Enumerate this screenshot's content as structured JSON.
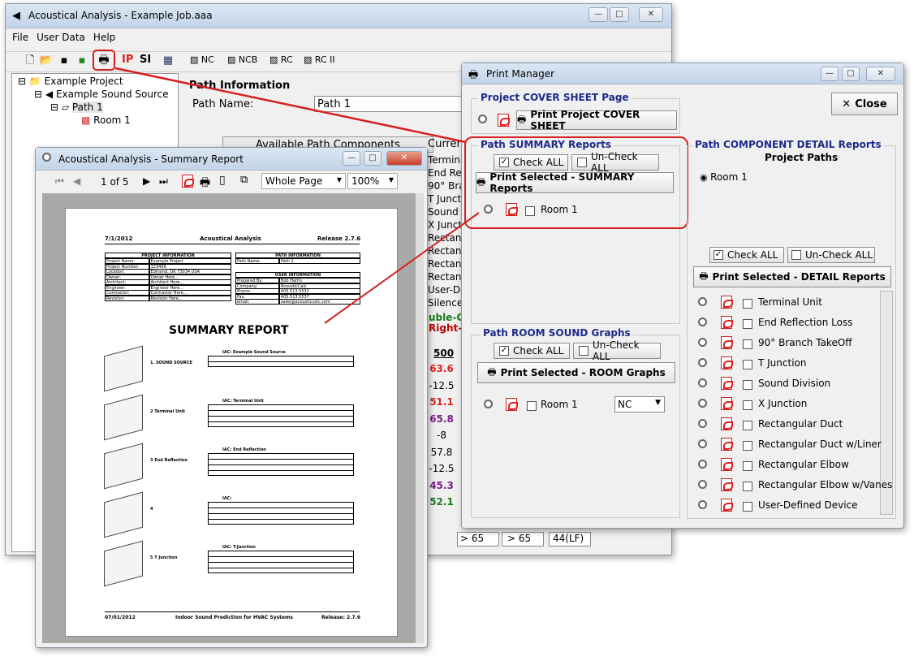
{
  "main": {
    "title": "Acoustical Analysis - Example Job.aaa",
    "menu": [
      "File",
      "User Data",
      "Help"
    ],
    "toolbar": {
      "ip": "IP",
      "si": "SI",
      "nc": "NC",
      "ncb": "NCB",
      "rc": "RC",
      "rc2": "RC II"
    },
    "tree": {
      "project": "Example Project",
      "source": "Example Sound Source",
      "path": "Path 1",
      "room": "Room 1"
    },
    "path_info": {
      "heading": "Path Information",
      "name_label": "Path Name:",
      "name_value": "Path 1",
      "avail": "Available Path Components",
      "curr": "Curren"
    },
    "components": [
      "Terminal",
      "End Reflec",
      "90° Branch",
      "T Junction",
      "Sound Div",
      "X Junction",
      "Rectangu",
      "Rectangu",
      "Rectangu",
      "Rectangu",
      "User-Defi",
      "Silencer"
    ],
    "dbl_click": "uble-Clic",
    "right_click": "Right-Cl",
    "col_head": "500",
    "col_values": [
      {
        "v": "63.6",
        "c": "#d22"
      },
      {
        "v": "-12.5",
        "c": "#000"
      },
      {
        "v": "51.1",
        "c": "#d22"
      },
      {
        "v": "65.8",
        "c": "#7a1c8a"
      },
      {
        "v": "-8",
        "c": "#000"
      },
      {
        "v": "57.8",
        "c": "#000"
      },
      {
        "v": "-12.5",
        "c": "#000"
      },
      {
        "v": "45.3",
        "c": "#7a1c8a"
      },
      {
        "v": "52.1",
        "c": "#1a7a1a"
      }
    ],
    "bottom": [
      "> 65",
      "> 65",
      "44(LF)"
    ]
  },
  "summary": {
    "title": "Acoustical Analysis - Summary Report",
    "pages": "1 of 5",
    "zoom_mode": "Whole Page",
    "zoom_pct": "100%",
    "doc": {
      "date": "7/1/2012",
      "app": "Acoustical Analysis",
      "release": "Release 2.7.6",
      "proj_info": "PROJECT INFORMATION",
      "path_info": "PATH INFORMATION",
      "user_info": "USER INFORMATION",
      "proj_rows": [
        [
          "Project Name:",
          "Example Project"
        ],
        [
          "Project Number:",
          "123456"
        ],
        [
          "Location:",
          "Edmond, OK 73034 USA"
        ],
        [
          "Owner:",
          "Owner Here..."
        ],
        [
          "Architect:",
          "Architect Here..."
        ],
        [
          "Engineer:",
          "Engineer Here..."
        ],
        [
          "Contractor:",
          "Contractor Here..."
        ],
        [
          "Revision:",
          "Revision Here..."
        ]
      ],
      "path_rows": [
        [
          "Path Name:",
          "Path 1"
        ]
      ],
      "user_rows": [
        [
          "Prepared By:",
          "Bob Harris"
        ],
        [
          "Company:",
          "AcousticCalc"
        ],
        [
          "Phone:",
          "405.513.5532"
        ],
        [
          "Fax:",
          "405.513.5537"
        ],
        [
          "email:",
          "sales@acousticcalc.com"
        ]
      ],
      "heading": "SUMMARY REPORT",
      "items": [
        {
          "label": "1. SOUND SOURCE",
          "iac": "IAC: Example Sound Source"
        },
        {
          "label": "2 Terminal Unit",
          "iac": "IAC: Terminal Unit"
        },
        {
          "label": "3 End Reflection",
          "iac": "IAC: End Reflection"
        },
        {
          "label": "4",
          "iac": "IAC:"
        },
        {
          "label": "5 T Junction",
          "iac": "IAC: T-Junction"
        }
      ],
      "footer_date": "07/01/2012",
      "footer_mid": "Indoor Sound Prediction for HVAC Systems",
      "footer_rel": "Release: 2.7.6"
    }
  },
  "pm": {
    "title": "Print Manager",
    "close": "Close",
    "cover": {
      "title": "Project COVER SHEET Page",
      "btn": "Print Project COVER SHEET"
    },
    "summ": {
      "title": "Path SUMMARY Reports",
      "check": "Check ALL",
      "uncheck": "Un-Check ALL",
      "btn": "Print Selected - SUMMARY Reports",
      "room": "Room 1"
    },
    "room": {
      "title": "Path ROOM SOUND Graphs",
      "check": "Check ALL",
      "uncheck": "Un-Check ALL",
      "btn": "Print Selected - ROOM Graphs",
      "room": "Room 1",
      "sel": "NC"
    },
    "detail": {
      "title": "Path COMPONENT DETAIL Reports",
      "sub": "Project Paths",
      "radio": "Room 1",
      "check": "Check ALL",
      "uncheck": "Un-Check ALL",
      "btn": "Print Selected - DETAIL Reports",
      "items": [
        "Terminal Unit",
        "End Reflection Loss",
        "90° Branch TakeOff",
        "T Junction",
        "Sound Division",
        "X Junction",
        "Rectangular Duct",
        "Rectangular Duct w/Liner",
        "Rectangular Elbow",
        "Rectangular Elbow w/Vanes",
        "User-Defined Device"
      ]
    }
  },
  "colors": {
    "accent": "#d62020",
    "group_title": "#1c2a8c"
  }
}
